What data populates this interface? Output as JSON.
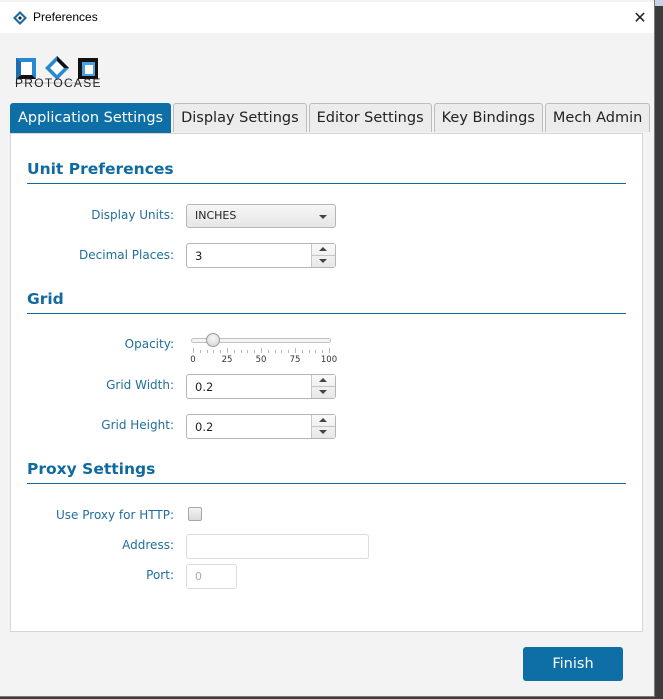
{
  "window": {
    "title": "Preferences",
    "app_icon": "protocase-app-icon",
    "close_icon": "close-icon"
  },
  "logo": {
    "text": "PROTOCASE"
  },
  "tabs": [
    {
      "label": "Application Settings",
      "active": true
    },
    {
      "label": "Display Settings",
      "active": false
    },
    {
      "label": "Editor Settings",
      "active": false
    },
    {
      "label": "Key Bindings",
      "active": false
    },
    {
      "label": "Mech Admin",
      "active": false
    }
  ],
  "unit_preferences": {
    "title": "Unit Preferences",
    "display_units": {
      "label": "Display Units:",
      "value": "INCHES"
    },
    "decimal_places": {
      "label": "Decimal Places:",
      "value": "3"
    }
  },
  "grid": {
    "title": "Grid",
    "opacity": {
      "label": "Opacity:",
      "value": 15,
      "min": 0,
      "max": 100,
      "tick_labels": [
        "0",
        "25",
        "50",
        "75",
        "100"
      ]
    },
    "grid_width": {
      "label": "Grid Width:",
      "value": "0.2"
    },
    "grid_height": {
      "label": "Grid Height:",
      "value": "0.2"
    }
  },
  "proxy": {
    "title": "Proxy Settings",
    "use_proxy": {
      "label": "Use Proxy for HTTP:",
      "checked": false
    },
    "address": {
      "label": "Address:",
      "value": ""
    },
    "port": {
      "label": "Port:",
      "placeholder": "0"
    }
  },
  "footer": {
    "finish_label": "Finish"
  },
  "colors": {
    "accent": "#0d6fa6",
    "label": "#1f6e9d"
  }
}
